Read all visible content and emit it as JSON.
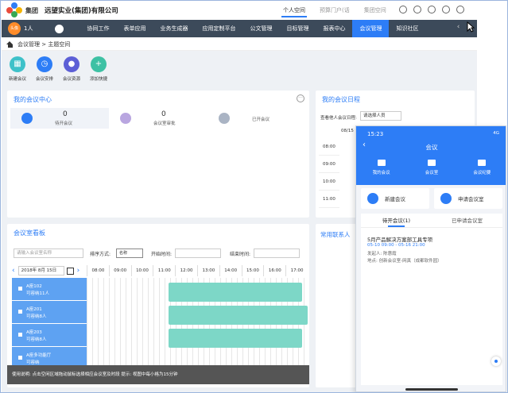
{
  "header": {
    "org_tag": "集团",
    "company": "远望实业(集团)有限公司",
    "top_links": [
      "个人空间",
      "预算门户(话",
      "集团空间"
    ]
  },
  "nav": {
    "avatar_text": "头像",
    "user_count": "1人",
    "items": [
      "协同工作",
      "表单应用",
      "业务生成器",
      "应用定制平台",
      "公文管理",
      "目标管理",
      "报表中心",
      "会议管理",
      "知识社区"
    ]
  },
  "breadcrumb": "会议管理 > 主题空间",
  "quick_actions": [
    {
      "label": "新建会议",
      "color": "#3ec1c9",
      "icon": "plus-calendar-icon"
    },
    {
      "label": "会议安排",
      "color": "#2d7df6",
      "icon": "clock-icon"
    },
    {
      "label": "会议资源",
      "color": "#5c5fd6",
      "icon": "people-icon"
    },
    {
      "label": "添加快捷",
      "color": "#3ec1a4",
      "icon": "plus-icon"
    }
  ],
  "center": {
    "title": "我的会议中心",
    "stats": [
      {
        "value": "0",
        "label": "待开会议"
      },
      {
        "value": "0",
        "label": "会议室审批"
      },
      {
        "value": "",
        "label": "已开会议"
      }
    ]
  },
  "schedule": {
    "title": "我的会议日程",
    "label": "查看他人会议日程:",
    "select_placeholder": "请选择人员",
    "date": "08/15",
    "times": [
      "08:00",
      "09:00",
      "10:00",
      "11:00"
    ]
  },
  "board": {
    "title": "会议室看板",
    "search_placeholder": "请输入会议室名称",
    "sort_label": "排序方式:",
    "sort_value": "名称",
    "start_label": "开始时间:",
    "end_label": "结束时间:",
    "date": "2018年 8月 15日",
    "hours": [
      "08:00",
      "09:00",
      "10:00",
      "11:00",
      "12:00",
      "13:00",
      "14:00",
      "15:00",
      "16:00",
      "17:00"
    ],
    "rooms": [
      {
        "name": "A座102",
        "capacity": "可容纳11人"
      },
      {
        "name": "A座201",
        "capacity": "可容纳8人"
      },
      {
        "name": "A座203",
        "capacity": "可容纳8人"
      },
      {
        "name": "A座多功能厅",
        "capacity": "可容纳"
      }
    ],
    "notice": "使用说明: 点击空闲区域拖动鼠标选择相应会议室及时段 提示: 视图中每小格为15分钟"
  },
  "contacts": {
    "title": "常用联系人"
  },
  "phone": {
    "time": "15:23",
    "status": "4G",
    "title": "会议",
    "tabs": [
      "我的会议",
      "会议室",
      "会议纪要"
    ],
    "cards": [
      "新建会议",
      "申请会议室"
    ],
    "segments": [
      "待开会议(1)",
      "已申请会议室"
    ],
    "item": {
      "title": "5月产品解决方案部工具专项",
      "time": "05-10 09:00 - 05-16 21:00",
      "initiator": "发起人: 陈惠霞",
      "place": "地点: 创新会议室-网真（成都软件园）"
    }
  }
}
